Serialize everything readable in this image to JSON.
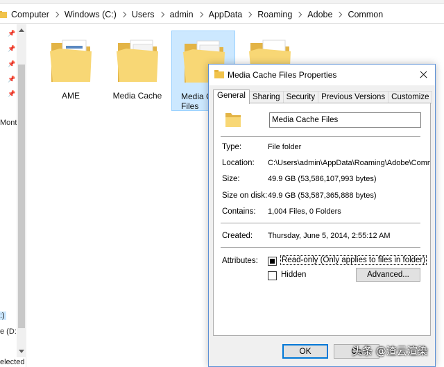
{
  "explorer": {
    "breadcrumb": [
      "Computer",
      "Windows (C:)",
      "Users",
      "admin",
      "AppData",
      "Roaming",
      "Adobe",
      "Common"
    ],
    "nav_fragments": {
      "mont": "Mont",
      "drive_c": ":)",
      "drive_d": "e (D:",
      "status": "elected"
    },
    "folders": [
      {
        "label": "AME",
        "selected": false
      },
      {
        "label": "Media Cache",
        "selected": false
      },
      {
        "label": "Media Cache Files",
        "label_visible": "Media C\nFiles",
        "selected": true
      },
      {
        "label": "",
        "selected": false
      }
    ]
  },
  "dialog": {
    "title": "Media Cache Files Properties",
    "tabs": [
      "General",
      "Sharing",
      "Security",
      "Previous Versions",
      "Customize"
    ],
    "active_tab": "General",
    "name_value": "Media Cache Files",
    "properties": [
      {
        "label": "Type:",
        "value": "File folder"
      },
      {
        "label": "Location:",
        "value": "C:\\Users\\admin\\AppData\\Roaming\\Adobe\\Common"
      },
      {
        "label": "Size:",
        "value": "49.9 GB (53,586,107,993 bytes)"
      },
      {
        "label": "Size on disk:",
        "value": "49.9 GB (53,587,365,888 bytes)"
      },
      {
        "label": "Contains:",
        "value": "1,004 Files, 0 Folders"
      }
    ],
    "created_label": "Created:",
    "created_value": "Thursday, June 5, 2014, 2:55:12 AM",
    "attributes_label": "Attributes:",
    "readonly_label": "Read-only (Only applies to files in folder)",
    "hidden_label": "Hidden",
    "advanced_label": "Advanced...",
    "ok_label": "OK",
    "cancel_label": "Ca"
  },
  "watermark": "头条 @渣云渲染",
  "colors": {
    "selection": "#cce8ff",
    "folder_yellow": "#f8d775",
    "dialog_border": "#5a8fd6",
    "default_button": "#0078d7"
  }
}
